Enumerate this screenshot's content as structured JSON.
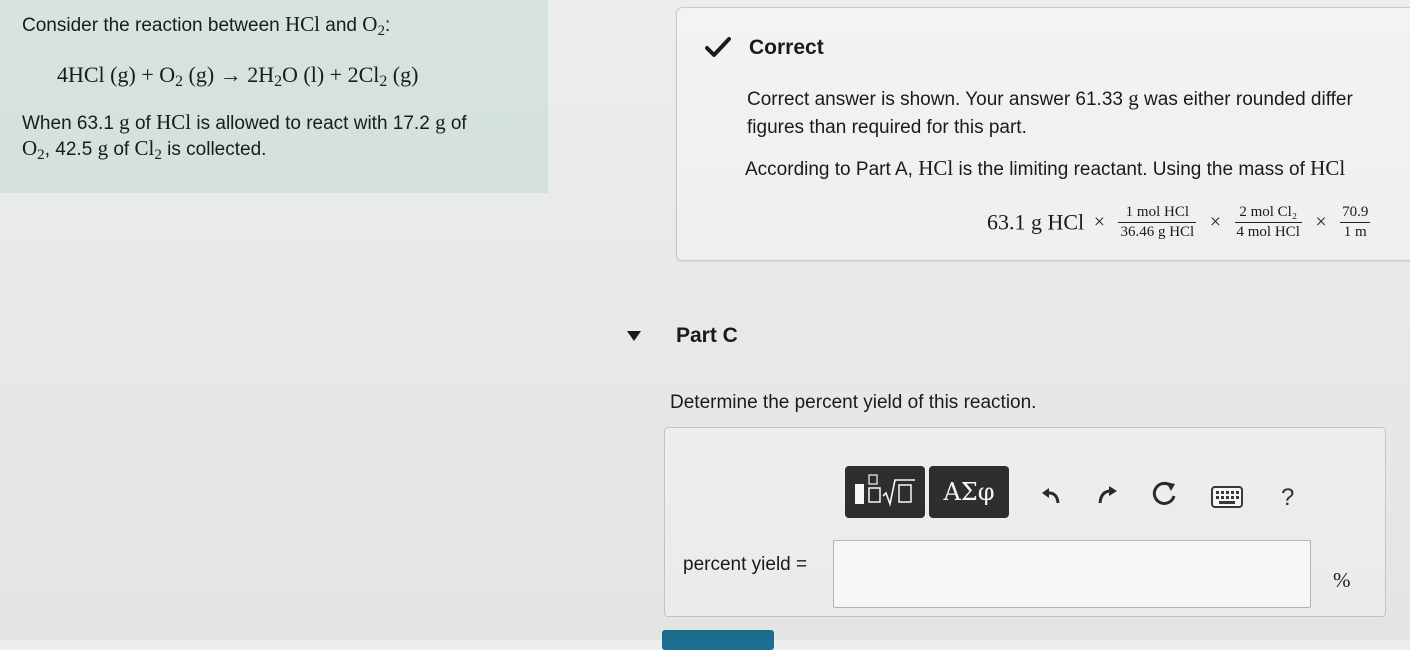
{
  "problem": {
    "intro_prefix": "Consider the reaction between ",
    "intro_hcl": "HCl",
    "intro_and": " and ",
    "intro_o": "O",
    "intro_o_sub": "2",
    "intro_colon": ":",
    "eq_part1": "4HCl (g) + O",
    "eq_sub1": "2",
    "eq_part2": " (g) → 2H",
    "eq_sub2": "2",
    "eq_part3": "O (l) + 2Cl",
    "eq_sub3": "2",
    "eq_part4": " (g)",
    "stmt_1": "When 63.1 ",
    "stmt_g1": "g",
    "stmt_2": " of ",
    "stmt_hcl": "HCl",
    "stmt_3": " is allowed to react with 17.2 ",
    "stmt_g2": "g",
    "stmt_4": " of",
    "stmt_o": "O",
    "stmt_o_sub": "2",
    "stmt_5": ", 42.5 ",
    "stmt_g3": "g",
    "stmt_6": " of ",
    "stmt_cl": "Cl",
    "stmt_cl_sub": "2",
    "stmt_7": " is collected."
  },
  "feedback": {
    "title": "Correct",
    "msg_1": "Correct answer is shown. Your answer 61.33 ",
    "msg_g": "g",
    "msg_2": " was either rounded differ",
    "msg_line2": "figures than required for this part.",
    "explain_1": "According to Part A, ",
    "explain_hcl": "HCl",
    "explain_2": " is the limiting reactant. Using the mass of ",
    "explain_hcl2": "HCl",
    "calc": {
      "start": "63.1 g HCl",
      "times": "×",
      "f1_num": "1 mol HCl",
      "f1_den": "36.46 g HCl",
      "f2_num": "2 mol Cl₂",
      "f2_den": "4 mol HCl",
      "f3_num": "70.9",
      "f3_den": "1 m"
    }
  },
  "part_c": {
    "title": "Part C",
    "question": "Determine the percent yield of this reaction.",
    "symbols_label": "ΑΣφ",
    "help_label": "?",
    "input_label": "percent yield =",
    "input_value": "",
    "unit": "%"
  },
  "icons": {
    "check": "check-icon",
    "toggle": "triangle-down-icon",
    "templates": "math-templates-icon",
    "undo": "undo-icon",
    "redo": "redo-icon",
    "reset": "reset-icon",
    "keyboard": "keyboard-icon"
  },
  "colors": {
    "problem_bg": "#d6e3e1",
    "toolbar_button": "#2d2f30",
    "submit": "#1c6f8f"
  }
}
